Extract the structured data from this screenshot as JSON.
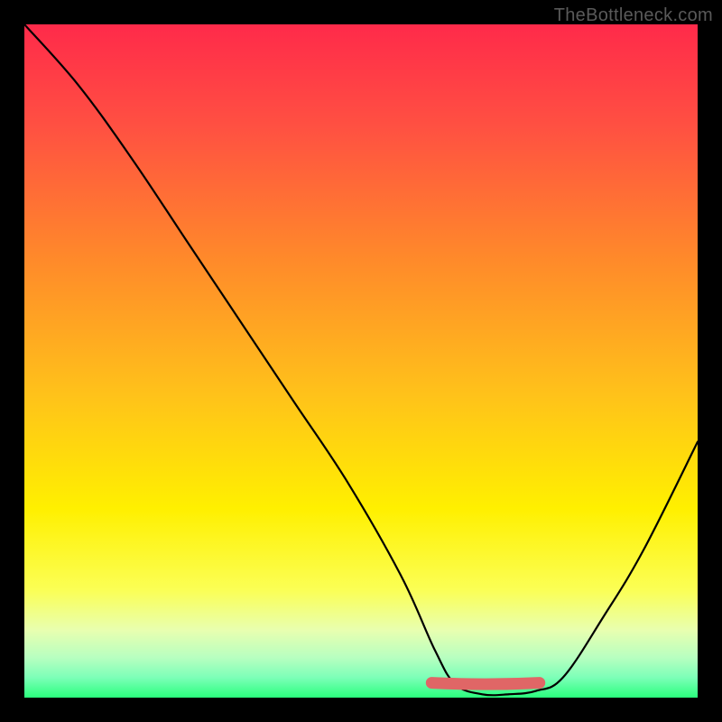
{
  "watermark": "TheBottleneck.com",
  "chart_data": {
    "type": "line",
    "title": "",
    "xlabel": "",
    "ylabel": "",
    "xlim": [
      0,
      100
    ],
    "ylim": [
      0,
      100
    ],
    "series": [
      {
        "name": "curve",
        "x": [
          0,
          8,
          16,
          24,
          32,
          40,
          48,
          56,
          61,
          64,
          68,
          72,
          76,
          80,
          86,
          92,
          100
        ],
        "values": [
          100,
          91,
          80,
          68,
          56,
          44,
          32,
          18,
          7,
          2,
          0.5,
          0.5,
          1,
          3,
          12,
          22,
          38
        ]
      },
      {
        "name": "flat-highlight",
        "x": [
          60.5,
          76.5
        ],
        "values": [
          2.2,
          2.2
        ]
      }
    ],
    "gradient_bands": [
      {
        "color": "#ff2a4a",
        "stop": 0
      },
      {
        "color": "#ff5042",
        "stop": 15
      },
      {
        "color": "#ff8a2a",
        "stop": 35
      },
      {
        "color": "#ffc21a",
        "stop": 55
      },
      {
        "color": "#fff000",
        "stop": 72
      },
      {
        "color": "#fbff55",
        "stop": 84
      },
      {
        "color": "#e8ffb0",
        "stop": 90
      },
      {
        "color": "#b8ffc0",
        "stop": 94
      },
      {
        "color": "#7dffb8",
        "stop": 97
      },
      {
        "color": "#2aff7d",
        "stop": 100
      }
    ]
  }
}
